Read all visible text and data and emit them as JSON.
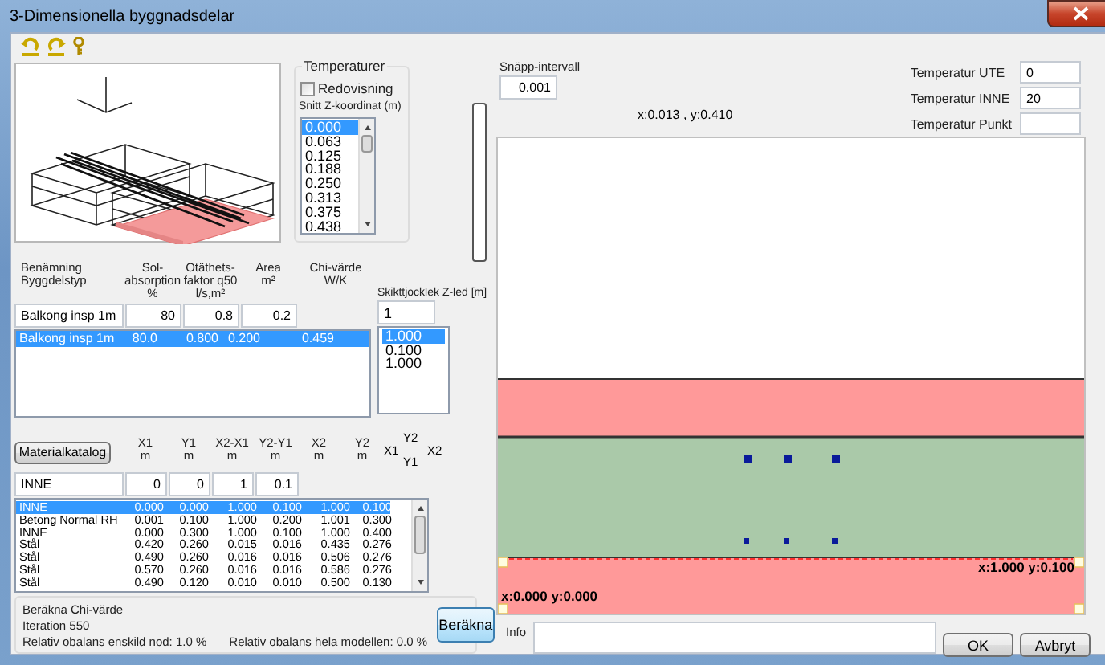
{
  "window": {
    "title": "3-Dimensionella byggnadsdelar"
  },
  "temperatures": {
    "label": "Temperaturer",
    "report": {
      "label": "Redovisning",
      "checked": false
    },
    "z_label": "Snitt Z-koordinat (m)",
    "z_values": [
      {
        "label": "0.000",
        "selected": true
      },
      {
        "label": "0.063",
        "selected": false
      },
      {
        "label": "0.125",
        "selected": false
      },
      {
        "label": "0.188",
        "selected": false
      },
      {
        "label": "0.250",
        "selected": false
      },
      {
        "label": "0.313",
        "selected": false
      },
      {
        "label": "0.375",
        "selected": false
      },
      {
        "label": "0.438",
        "selected": false
      }
    ]
  },
  "building_part": {
    "columns": [
      "Benämning\nByggdelstyp",
      "Sol-\nabsorption\n%",
      "Otäthets-\nfaktor q50\nl/s,m²",
      "Area\nm²",
      "Chi-värde\nW/K"
    ],
    "inputs": [
      "Balkong insp 1m",
      "80",
      "0.8",
      "0.2"
    ],
    "rows": [
      {
        "cells": [
          "Balkong insp 1m",
          "80.0",
          "0.800",
          "0.200",
          "0.459"
        ],
        "selected": true
      }
    ]
  },
  "layer_thickness": {
    "label": "Skikttjocklek Z-led [m]",
    "value": "1",
    "items": [
      {
        "label": "1.000",
        "selected": true
      },
      {
        "label": "0.100",
        "selected": false
      },
      {
        "label": "1.000",
        "selected": false
      }
    ]
  },
  "materials": {
    "catalog_button": "Materialkatalog",
    "columns": [
      "",
      "X1\nm",
      "Y1\nm",
      "X2-X1\nm",
      "Y2-Y1\nm",
      "X2\nm",
      "Y2\nm"
    ],
    "legend": [
      "X1",
      "Y2",
      "X2",
      "Y1"
    ],
    "inputs": [
      "INNE",
      "0",
      "0",
      "1",
      "0.1"
    ],
    "rows": [
      {
        "cells": [
          "INNE",
          "0.000",
          "0.000",
          "1.000",
          "0.100",
          "1.000",
          "0.100"
        ],
        "selected": true
      },
      {
        "cells": [
          "Betong Normal RH",
          "0.001",
          "0.100",
          "1.000",
          "0.200",
          "1.001",
          "0.300"
        ],
        "selected": false
      },
      {
        "cells": [
          "INNE",
          "0.000",
          "0.300",
          "1.000",
          "0.100",
          "1.000",
          "0.400"
        ],
        "selected": false
      },
      {
        "cells": [
          "Stål",
          "0.420",
          "0.260",
          "0.015",
          "0.016",
          "0.435",
          "0.276"
        ],
        "selected": false
      },
      {
        "cells": [
          "Stål",
          "0.490",
          "0.260",
          "0.016",
          "0.016",
          "0.506",
          "0.276"
        ],
        "selected": false
      },
      {
        "cells": [
          "Stål",
          "0.570",
          "0.260",
          "0.016",
          "0.016",
          "0.586",
          "0.276"
        ],
        "selected": false
      },
      {
        "cells": [
          "Stål",
          "0.490",
          "0.120",
          "0.010",
          "0.010",
          "0.500",
          "0.130"
        ],
        "selected": false
      }
    ]
  },
  "calculation": {
    "label": "Beräkna Chi-värde",
    "iteration": "Iteration 550",
    "node_imbalance": "Relativ obalans enskild nod: 1.0 %",
    "model_imbalance": "Relativ obalans hela modellen: 0.0 %",
    "button": "Beräkna"
  },
  "snap": {
    "label": "Snäpp-intervall",
    "value": "0.001"
  },
  "cursor": "x:0.013 , y:0.410",
  "temperature_fields": [
    {
      "label": "Temperatur UTE",
      "value": "0"
    },
    {
      "label": "Temperatur INNE",
      "value": "20"
    },
    {
      "label": "Temperatur Punkt"
    }
  ],
  "canvas": {
    "layers": [
      {
        "color": "#ff9999"
      },
      {
        "color": "#aac9a9"
      },
      {
        "color": "#ff9999"
      }
    ],
    "point_labels": [
      "x:1.000 y:0.100",
      "x:0.000 y:0.000"
    ]
  },
  "info": {
    "label": "Info"
  },
  "buttons": [
    "OK",
    "Avbryt"
  ]
}
